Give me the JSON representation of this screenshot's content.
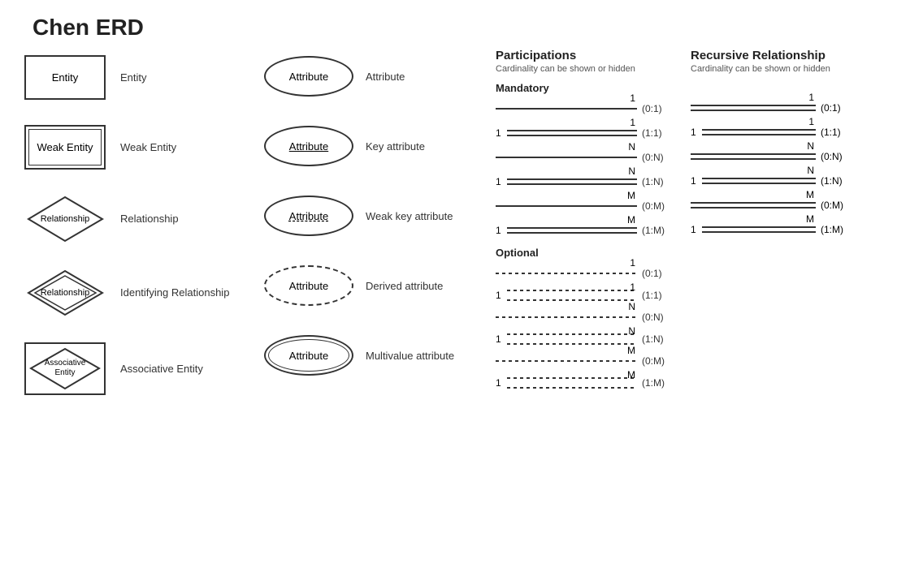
{
  "title": "Chen ERD",
  "shapes": [
    {
      "id": "entity",
      "label": "Entity",
      "type": "entity"
    },
    {
      "id": "weak-entity",
      "label": "Weak Entity",
      "type": "weak-entity"
    },
    {
      "id": "relationship",
      "label": "Relationship",
      "type": "relationship"
    },
    {
      "id": "identifying-rel",
      "label": "Identifying Relationship",
      "type": "identifying-relationship"
    },
    {
      "id": "associative-entity",
      "label": "Associative Entity",
      "type": "associative-entity"
    }
  ],
  "attributes": [
    {
      "id": "attribute",
      "label": "Attribute",
      "type": "attribute"
    },
    {
      "id": "key-attribute",
      "label": "Key attribute",
      "type": "key-attribute"
    },
    {
      "id": "weak-key-attribute",
      "label": "Weak key attribute",
      "type": "weak-key-attribute"
    },
    {
      "id": "derived-attribute",
      "label": "Derived attribute",
      "type": "derived-attribute"
    },
    {
      "id": "multivalue-attribute",
      "label": "Multivalue attribute",
      "type": "multivalue-attribute"
    }
  ],
  "participations": {
    "title": "Participations",
    "subtitle": "Cardinality can be shown or hidden",
    "mandatory_label": "Mandatory",
    "optional_label": "Optional",
    "mandatory_rows": [
      {
        "left": "",
        "right": "1",
        "cardinality": "(0:1)",
        "line": "solid"
      },
      {
        "left": "1",
        "right": "1",
        "cardinality": "(1:1)",
        "line": "double"
      },
      {
        "left": "",
        "right": "N",
        "cardinality": "(0:N)",
        "line": "solid"
      },
      {
        "left": "1",
        "right": "N",
        "cardinality": "(1:N)",
        "line": "double"
      },
      {
        "left": "",
        "right": "M",
        "cardinality": "(0:M)",
        "line": "solid"
      },
      {
        "left": "1",
        "right": "M",
        "cardinality": "(1:M)",
        "line": "double"
      }
    ],
    "optional_rows": [
      {
        "left": "",
        "right": "1",
        "cardinality": "(0:1)",
        "line": "dashed"
      },
      {
        "left": "1",
        "right": "1",
        "cardinality": "(1:1)",
        "line": "dashed-pair"
      },
      {
        "left": "",
        "right": "N",
        "cardinality": "(0:N)",
        "line": "dashed"
      },
      {
        "left": "1",
        "right": "N",
        "cardinality": "(1:N)",
        "line": "dashed-pair"
      },
      {
        "left": "",
        "right": "M",
        "cardinality": "(0:M)",
        "line": "dashed"
      },
      {
        "left": "1",
        "right": "M",
        "cardinality": "(1:M)",
        "line": "dashed-pair"
      }
    ]
  },
  "recursive": {
    "title": "Recursive Relationship",
    "subtitle": "Cardinality can be shown or hidden",
    "rows": [
      {
        "left": "",
        "right": "1",
        "cardinality": "(0:1)",
        "line": "double"
      },
      {
        "left": "1",
        "right": "1",
        "cardinality": "(1:1)",
        "line": "double"
      },
      {
        "left": "",
        "right": "N",
        "cardinality": "(0:N)",
        "line": "double"
      },
      {
        "left": "1",
        "right": "N",
        "cardinality": "(1:N)",
        "line": "double"
      },
      {
        "left": "",
        "right": "M",
        "cardinality": "(0:M)",
        "line": "double"
      },
      {
        "left": "1",
        "right": "M",
        "cardinality": "(1:M)",
        "line": "double"
      }
    ]
  }
}
